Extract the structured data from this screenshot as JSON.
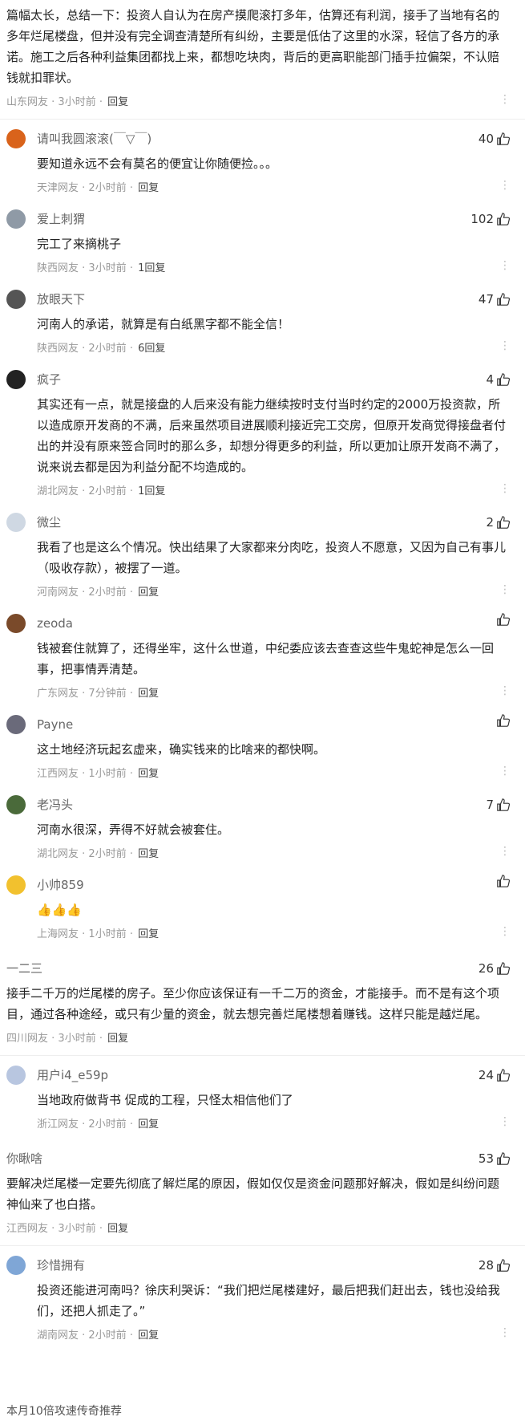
{
  "top_comment": {
    "body": "篇幅太长，总结一下：投资人自认为在房产摸爬滚打多年，估算还有利润，接手了当地有名的多年烂尾楼盘，但并没有完全调查清楚所有纠纷，主要是低估了这里的水深，轻信了各方的承诺。施工之后各种利益集团都找上来，都想吃块肉，背后的更高职能部门插手拉偏架，不认赔钱就扣罪状。",
    "location": "山东网友",
    "time": "3小时前",
    "reply": "回复"
  },
  "replies_1": [
    {
      "name": "请叫我圆滚滚(￣▽￣)",
      "likes": "40",
      "body": "要知道永远不会有莫名的便宜让你随便捡。。。",
      "location": "天津网友",
      "time": "2小时前",
      "reply": "回复",
      "avatar_color": "#d9631b"
    },
    {
      "name": "爱上刺猬",
      "likes": "102",
      "body": "完工了来摘桃子",
      "location": "陕西网友",
      "time": "3小时前",
      "reply": "1回复",
      "avatar_color": "#8f9aa6"
    },
    {
      "name": "放眼天下",
      "likes": "47",
      "body": "河南人的承诺，就算是有白纸黑字都不能全信！",
      "location": "陕西网友",
      "time": "2小时前",
      "reply": "6回复",
      "avatar_color": "#555"
    },
    {
      "name": "疯子",
      "likes": "4",
      "body": "其实还有一点，就是接盘的人后来没有能力继续按时支付当时约定的2000万投资款，所以造成原开发商的不满，后来虽然项目进展顺利接近完工交房，但原开发商觉得接盘者付出的并没有原来签合同时的那么多，却想分得更多的利益，所以更加让原开发商不满了，说来说去都是因为利益分配不均造成的。",
      "location": "湖北网友",
      "time": "2小时前",
      "reply": "1回复",
      "avatar_color": "#222"
    },
    {
      "name": "微尘",
      "likes": "2",
      "body": "我看了也是这么个情况。快出结果了大家都来分肉吃，投资人不愿意，又因为自己有事儿（吸收存款），被摆了一道。",
      "location": "河南网友",
      "time": "2小时前",
      "reply": "回复",
      "avatar_color": "#cfd8e3"
    },
    {
      "name": "zeoda",
      "likes": "",
      "body": "钱被套住就算了，还得坐牢，这什么世道，中纪委应该去查查这些牛鬼蛇神是怎么一回事，把事情弄清楚。",
      "location": "广东网友",
      "time": "7分钟前",
      "reply": "回复",
      "avatar_color": "#7a4a2a"
    },
    {
      "name": "Payne",
      "likes": "",
      "body": "这土地经济玩起玄虚来，确实钱来的比啥来的都快啊。",
      "location": "江西网友",
      "time": "1小时前",
      "reply": "回复",
      "avatar_color": "#6a6a7a"
    },
    {
      "name": "老冯头",
      "likes": "7",
      "body": "河南水很深，弄得不好就会被套住。",
      "location": "湖北网友",
      "time": "2小时前",
      "reply": "回复",
      "avatar_color": "#4a6a3a"
    },
    {
      "name": "小帅859",
      "likes": "",
      "body": "👍👍👍",
      "location": "上海网友",
      "time": "1小时前",
      "reply": "回复",
      "avatar_color": "#f2c12e"
    }
  ],
  "comment_2": {
    "name": "一二三",
    "likes": "26",
    "body": "接手二千万的烂尾楼的房子。至少你应该保证有一千二万的资金，才能接手。而不是有这个项目，通过各种途经，或只有少量的资金，就去想完善烂尾楼想着赚钱。这样只能是越烂尾。",
    "location": "四川网友",
    "time": "3小时前",
    "reply": "回复"
  },
  "replies_2": [
    {
      "name": "用户i4_e59p",
      "likes": "24",
      "body": "当地政府做背书 促成的工程，只怪太相信他们了",
      "location": "浙江网友",
      "time": "2小时前",
      "reply": "回复",
      "avatar_color": "#b8c6e0"
    }
  ],
  "comment_3": {
    "name": "你瞅啥",
    "likes": "53",
    "body": "要解决烂尾楼一定要先彻底了解烂尾的原因，假如仅仅是资金问题那好解决，假如是纠纷问题神仙来了也白搭。",
    "location": "江西网友",
    "time": "3小时前",
    "reply": "回复"
  },
  "replies_3": [
    {
      "name": "珍惜拥有",
      "likes": "28",
      "body": "投资还能进河南吗？徐庆利哭诉：“我们把烂尾楼建好，最后把我们赶出去，钱也没给我们，还把人抓走了。”",
      "location": "湖南网友",
      "time": "2小时前",
      "reply": "回复",
      "avatar_color": "#7fa6d6"
    }
  ],
  "footer": {
    "text": "本月10倍攻速传奇推荐"
  },
  "meta": {
    "separator": " · ",
    "dots": "⋮"
  },
  "colors": {
    "name": "#666666",
    "meta": "#999999",
    "body": "#222222"
  }
}
